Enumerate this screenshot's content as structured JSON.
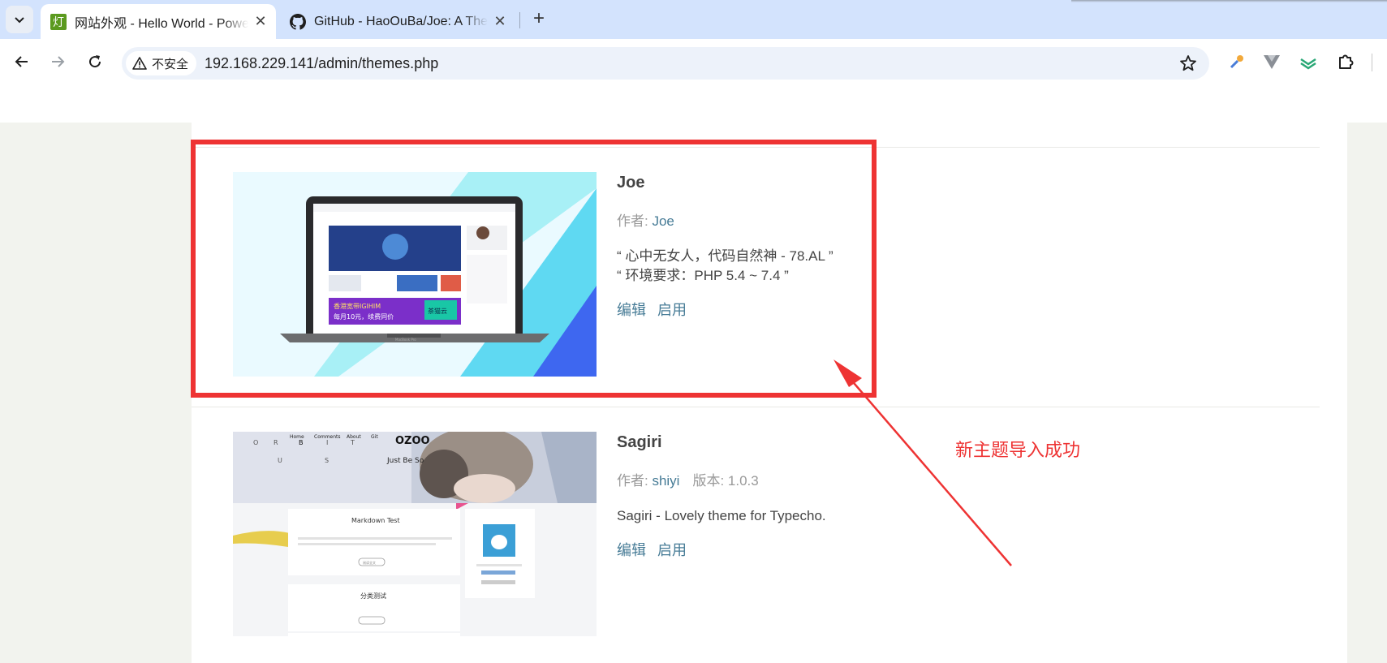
{
  "browser": {
    "tabs": [
      {
        "title": "网站外观 - Hello World - Powered by Typecho",
        "favicon_text": "灯",
        "active": true
      },
      {
        "title": "GitHub - HaoOuBa/Joe: A Theme for Typecho",
        "active": false
      }
    ],
    "close_glyph": "✕",
    "new_tab_glyph": "+",
    "security_label": "不安全",
    "url": "192.168.229.141/admin/themes.php"
  },
  "themes": [
    {
      "name": "Joe",
      "author_label": "作者: ",
      "author": "Joe",
      "description_lines": [
        "“ 心中无女人，代码自然神 - 78.AL ”",
        "“ 环境要求：PHP 5.4 ~ 7.4 ”"
      ],
      "edit_label": "编辑",
      "activate_label": "启用",
      "screenshot": {
        "banner_text_1": "香港宽带IGIHIM",
        "banner_text_2": "每月10元，续费同价",
        "banner_brand": "茶猫云",
        "laptop_brand": "MacBook Pro"
      }
    },
    {
      "name": "Sagiri",
      "author_label": "作者: ",
      "author": "shiyi",
      "version_label": "版本: ",
      "version": "1.0.3",
      "description": "Sagiri - Lovely theme for Typecho.",
      "edit_label": "编辑",
      "activate_label": "启用",
      "screenshot": {
        "site_title": "Just Be So",
        "logo": "OZOO",
        "nav": [
          "Home",
          "Comments",
          "About",
          "Git"
        ],
        "letters": [
          "O",
          "R",
          "B",
          "I",
          "T",
          "U",
          "S"
        ],
        "card1_title": "Markdown Test",
        "card2_title": "分类测试",
        "read_more": "阅读全文"
      }
    }
  ],
  "annotation": {
    "text": "新主题导入成功",
    "color": "#ee3333"
  }
}
